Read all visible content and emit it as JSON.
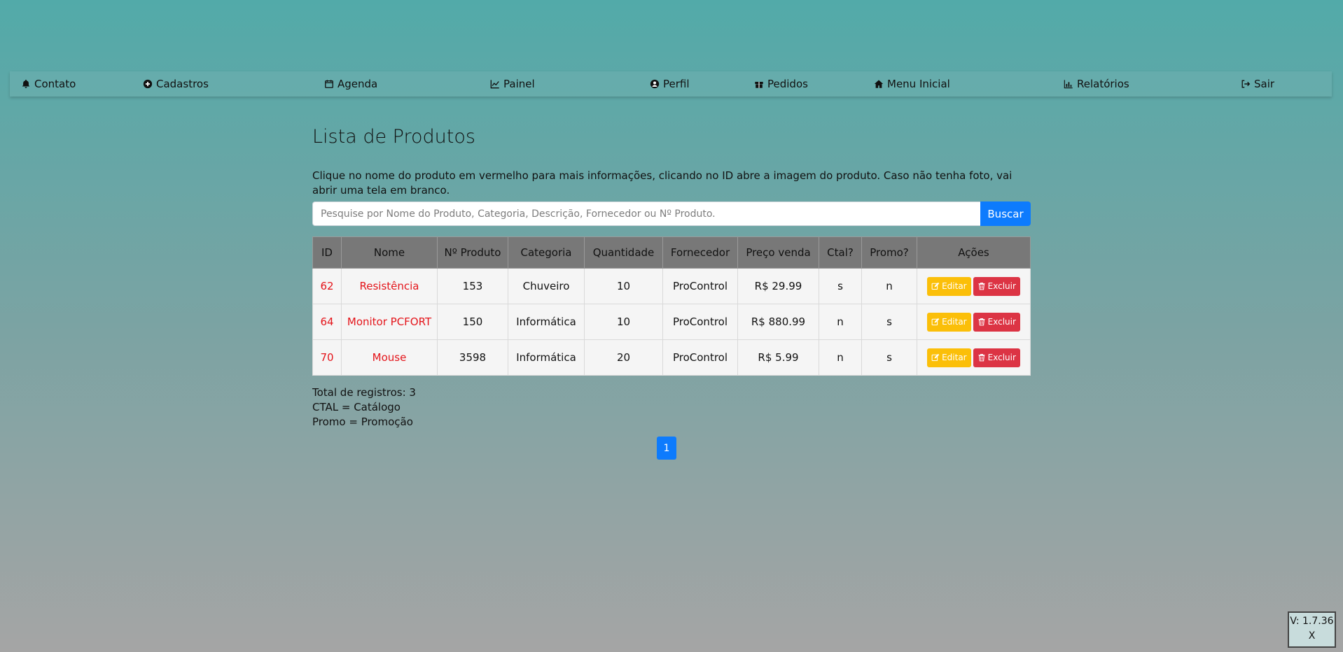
{
  "nav": [
    {
      "label": "Contato",
      "icon": "bell-icon"
    },
    {
      "label": "Cadastros",
      "icon": "plus-circle-icon"
    },
    {
      "label": "Agenda",
      "icon": "calendar-icon"
    },
    {
      "label": "Painel",
      "icon": "line-chart-icon"
    },
    {
      "label": "Perfil",
      "icon": "user-circle-icon"
    },
    {
      "label": "Pedidos",
      "icon": "gift-icon"
    },
    {
      "label": "Menu Inicial",
      "icon": "home-icon"
    },
    {
      "label": "Relatórios",
      "icon": "bar-chart-icon"
    },
    {
      "label": "Sair",
      "icon": "sign-out-icon"
    }
  ],
  "page": {
    "title": "Lista de Produtos",
    "info": "Clique no nome do produto em vermelho para mais informações, clicando no ID abre a imagem do produto. Caso não tenha foto, vai abrir uma tela em branco.",
    "search_placeholder": "Pesquise por Nome do Produto, Categoria, Descrição, Fornecedor ou Nº Produto.",
    "search_button": "Buscar"
  },
  "table": {
    "headers": [
      "ID",
      "Nome",
      "Nº Produto",
      "Categoria",
      "Quantidade",
      "Fornecedor",
      "Preço venda",
      "Ctal?",
      "Promo?",
      "Ações"
    ],
    "rows": [
      {
        "id": "62",
        "nome": "Resistência",
        "numero": "153",
        "categoria": "Chuveiro",
        "quantidade": "10",
        "fornecedor": "ProControl",
        "preco": "R$ 29.99",
        "ctal": "s",
        "promo": "n"
      },
      {
        "id": "64",
        "nome": "Monitor PCFORT",
        "numero": "150",
        "categoria": "Informática",
        "quantidade": "10",
        "fornecedor": "ProControl",
        "preco": "R$ 880.99",
        "ctal": "n",
        "promo": "s"
      },
      {
        "id": "70",
        "nome": "Mouse",
        "numero": "3598",
        "categoria": "Informática",
        "quantidade": "20",
        "fornecedor": "ProControl",
        "preco": "R$ 5.99",
        "ctal": "n",
        "promo": "s"
      }
    ],
    "edit_label": "Editar",
    "delete_label": "Excluir"
  },
  "footer": {
    "total": "Total de registros: 3",
    "ctal_note": "CTAL = Catálogo",
    "promo_note": "Promo = Promoção"
  },
  "pagination": {
    "current": "1"
  },
  "version": {
    "label": "V: 1.7.36",
    "close": "X"
  },
  "colors": {
    "accent": "#0d7bfd",
    "warning": "#fbbf09",
    "danger": "#dc3444",
    "link_red": "#e4141a"
  }
}
